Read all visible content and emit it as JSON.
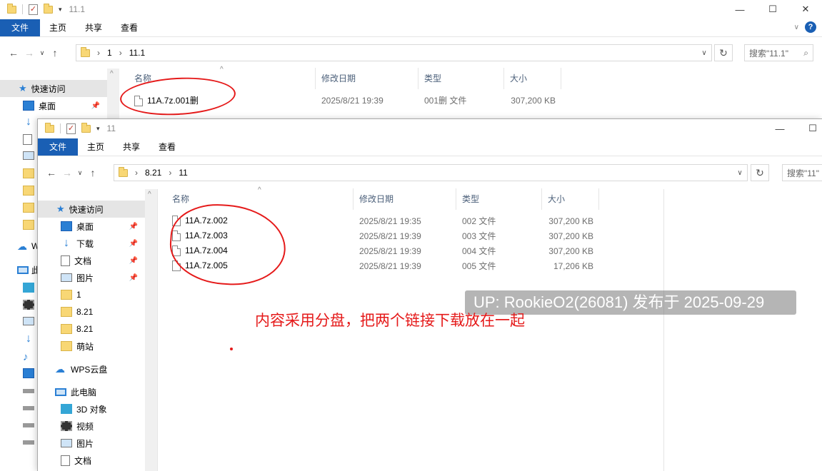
{
  "back": {
    "title": "11.1",
    "ribbon": {
      "file": "文件",
      "home": "主页",
      "share": "共享",
      "view": "查看"
    },
    "address": {
      "part1": "1",
      "part2": "11.1"
    },
    "search_placeholder": "搜索\"11.1\"",
    "tree": [
      {
        "label": "快速访问",
        "icon": "star-icon"
      },
      {
        "label": "桌面",
        "icon": "desktop-icon",
        "pinned": true
      }
    ],
    "headers": {
      "name": "名称",
      "date": "修改日期",
      "type": "类型",
      "size": "大小"
    },
    "files": [
      {
        "name": "11A.7z.001删",
        "date": "2025/8/21 19:39",
        "type": "001删 文件",
        "size": "307,200 KB"
      }
    ]
  },
  "front": {
    "title": "11",
    "ribbon": {
      "file": "文件",
      "home": "主页",
      "share": "共享",
      "view": "查看"
    },
    "address": {
      "part1": "8.21",
      "part2": "11"
    },
    "search_placeholder": "搜索\"11\"",
    "tree": [
      {
        "label": "快速访问"
      },
      {
        "label": "桌面"
      },
      {
        "label": "下载"
      },
      {
        "label": "文档"
      },
      {
        "label": "图片"
      },
      {
        "label": "1"
      },
      {
        "label": "8.21"
      },
      {
        "label": "8.21"
      },
      {
        "label": "萌站"
      },
      {
        "label": "WPS云盘"
      },
      {
        "label": "此电脑"
      },
      {
        "label": "3D 对象"
      },
      {
        "label": "视频"
      },
      {
        "label": "图片"
      },
      {
        "label": "文档"
      }
    ],
    "headers": {
      "name": "名称",
      "date": "修改日期",
      "type": "类型",
      "size": "大小"
    },
    "files": [
      {
        "name": "11A.7z.002",
        "date": "2025/8/21 19:35",
        "type": "002 文件",
        "size": "307,200 KB"
      },
      {
        "name": "11A.7z.003",
        "date": "2025/8/21 19:39",
        "type": "003 文件",
        "size": "307,200 KB"
      },
      {
        "name": "11A.7z.004",
        "date": "2025/8/21 19:39",
        "type": "004 文件",
        "size": "307,200 KB"
      },
      {
        "name": "11A.7z.005",
        "date": "2025/8/21 19:39",
        "type": "005 文件",
        "size": "17,206 KB"
      }
    ]
  },
  "back_tree_partial": {
    "w": "W",
    "ci": "此"
  },
  "watermark": "UP: RookieO2(26081) 发布于 2025-09-29",
  "annotation": "内容采用分盘，把两个链接下载放在一起"
}
